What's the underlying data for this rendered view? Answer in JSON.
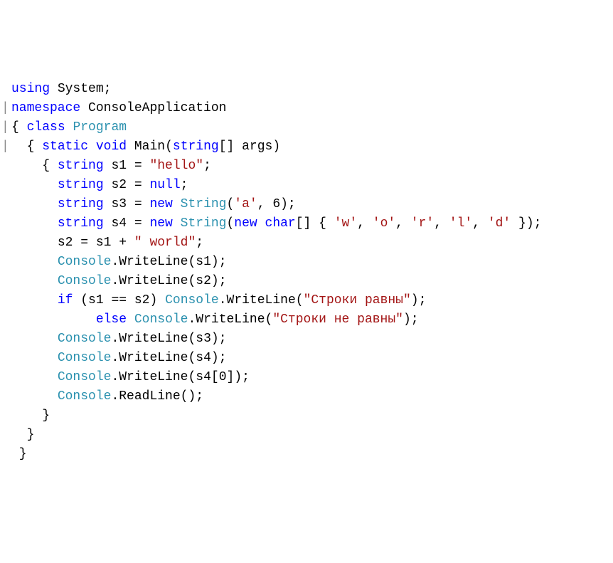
{
  "gutter": {
    "bar": "|"
  },
  "code": {
    "using": "using",
    "system": "System",
    "namespace": "namespace",
    "appname": "ConsoleApplication",
    "class": "class",
    "program": "Program",
    "static": "static",
    "void": "void",
    "main": "Main",
    "string": "string",
    "args": "args",
    "s1": "s1",
    "s2": "s2",
    "s3": "s3",
    "s4": "s4",
    "hello": "\"hello\"",
    "null": "null",
    "new": "new",
    "stringType": "String",
    "charA": "'a'",
    "six": "6",
    "char": "char",
    "chW": "'w'",
    "chO": "'o'",
    "chR": "'r'",
    "chL": "'l'",
    "chD": "'d'",
    "world": "\" world\"",
    "console": "Console",
    "writeLine": "WriteLine",
    "readLine": "ReadLine",
    "if": "if",
    "else": "else",
    "eq": "==",
    "strEqual": "\"Строки равны\"",
    "strNotEqual": "\"Строки не равны\"",
    "zero": "0"
  }
}
